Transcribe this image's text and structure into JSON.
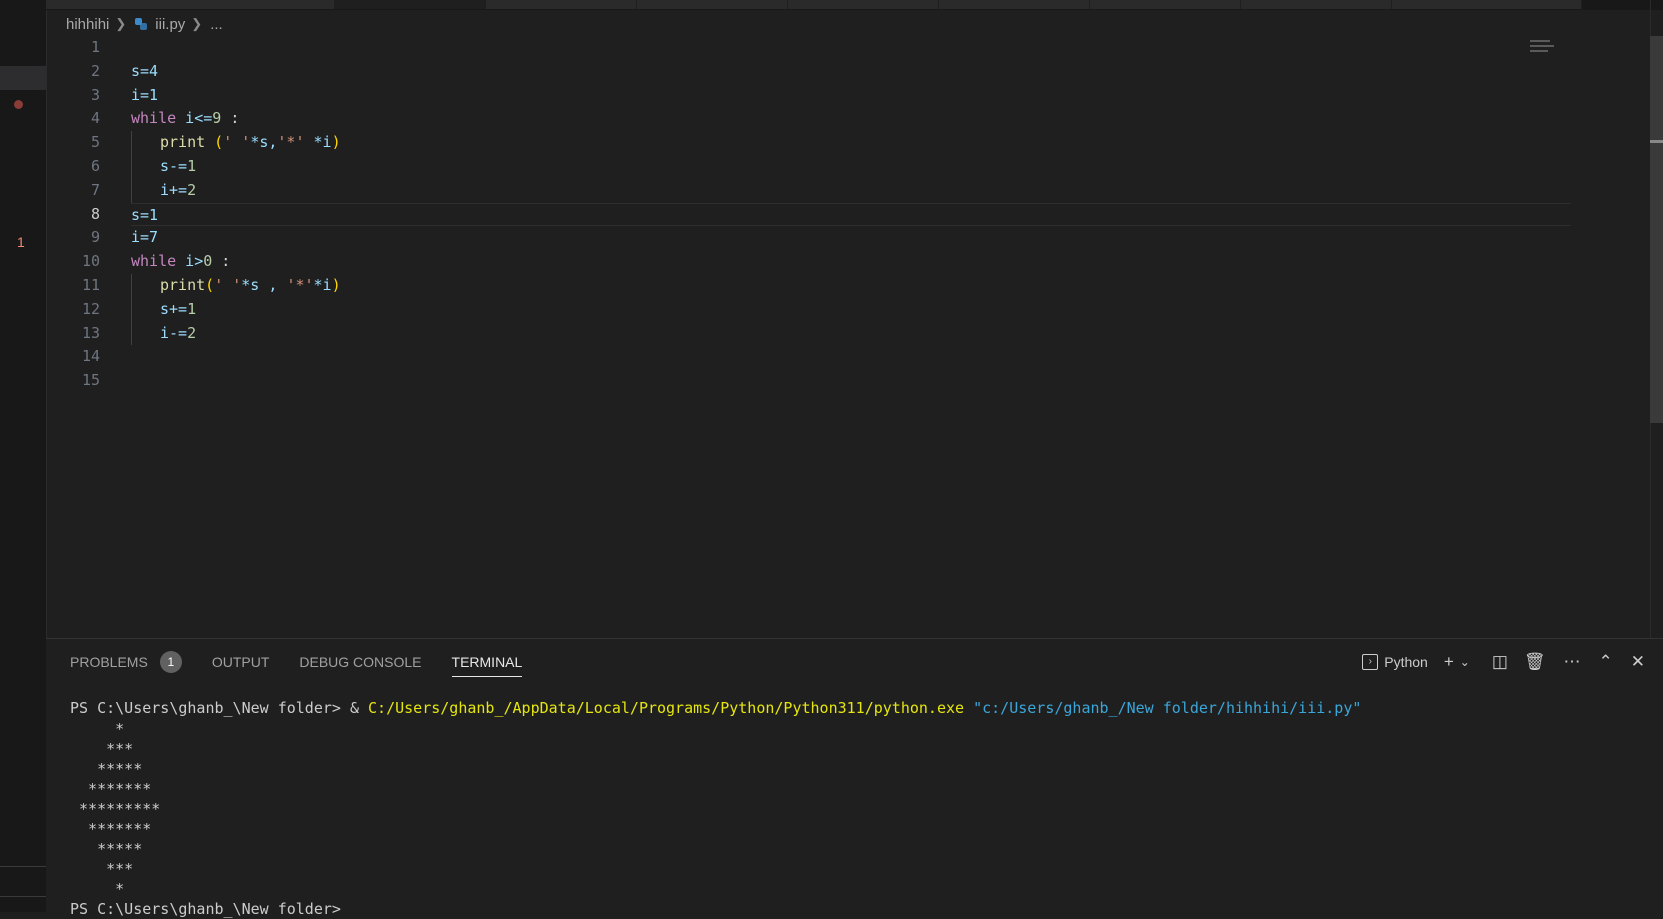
{
  "breadcrumb": {
    "folder": "hihhihi",
    "file": "iii.py",
    "more": "..."
  },
  "gutter": {
    "problem_count": "1"
  },
  "editor": {
    "line_numbers": [
      "1",
      "2",
      "3",
      "4",
      "5",
      "6",
      "7",
      "8",
      "9",
      "10",
      "11",
      "12",
      "13",
      "14",
      "15"
    ],
    "current_line": "8",
    "lines": {
      "l2": "s=4",
      "l3": "i=1",
      "l4_kw": "while",
      "l4_rest": " i<=",
      "l4_num": "9",
      "l4_end": " :",
      "l5_fn": "print",
      "l5_a": " (",
      "l5_s1": "' '",
      "l5_b": "*s,",
      "l5_s2": "'*'",
      "l5_c": " *i",
      "l5_close": ")",
      "l6": "s-=",
      "l6_num": "1",
      "l7": "i+=",
      "l7_num": "2",
      "l8": "s=1",
      "l9": "i=7",
      "l10_kw": "while",
      "l10_rest": " i>",
      "l10_num": "0",
      "l10_end": " :",
      "l11_fn": "print",
      "l11_open": "(",
      "l11_s1": "' '",
      "l11_b": "*s , ",
      "l11_s2": "'*'",
      "l11_c": "*i",
      "l11_close": ")",
      "l12": "s+=",
      "l12_num": "1",
      "l13": "i-=",
      "l13_num": "2"
    }
  },
  "panel": {
    "tabs": {
      "problems": "PROBLEMS",
      "problems_badge": "1",
      "output": "OUTPUT",
      "debug_console": "DEBUG CONSOLE",
      "terminal": "TERMINAL"
    },
    "shell_label": "Python"
  },
  "terminal": {
    "prompt": "PS C:\\Users\\ghanb_\\New folder> & ",
    "exe": "C:/Users/ghanb_/AppData/Local/Programs/Python/Python311/python.exe",
    "script": " \"c:/Users/ghanb_/New folder/hihhihi/iii.py\"",
    "output": [
      "     *",
      "    ***",
      "   *****",
      "  *******",
      " *********",
      "  *******",
      "   *****",
      "    ***",
      "     *"
    ],
    "last_prompt": "PS C:\\Users\\ghanb_\\New folder>"
  },
  "colors": {
    "keyword": "#c586c0",
    "function": "#dcdcaa",
    "number": "#b5cea8",
    "string": "#ce9178",
    "variable": "#9cdcfe",
    "exe_path": "#e5e510",
    "script_path": "#3ba6d9"
  }
}
